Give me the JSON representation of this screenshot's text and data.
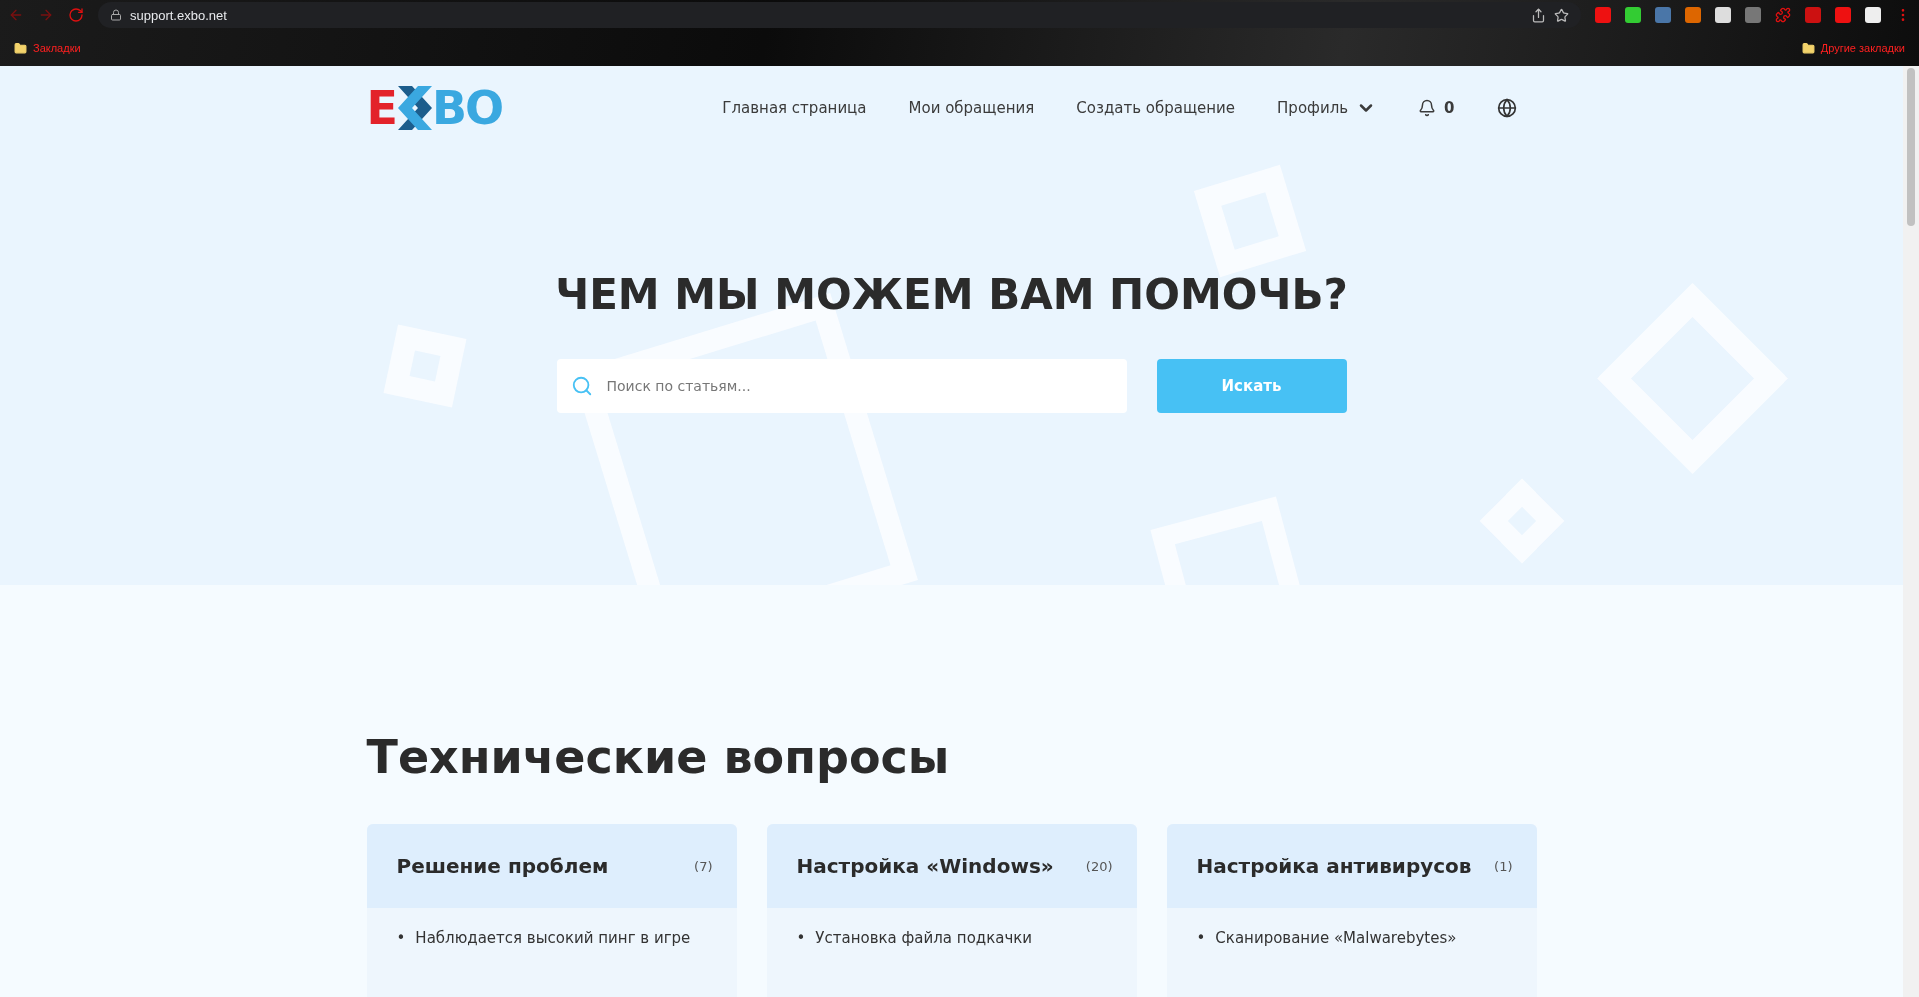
{
  "browser": {
    "url": "support.exbo.net",
    "bookmarks": "Закладки",
    "other_bookmarks": "Другие закладки"
  },
  "logo": {
    "left": "E",
    "right": "BO"
  },
  "nav": [
    {
      "label": "Главная страница",
      "kind": "link"
    },
    {
      "label": "Мои обращения",
      "kind": "link"
    },
    {
      "label": "Создать обращение",
      "kind": "link"
    },
    {
      "label": "Профиль",
      "kind": "dropdown"
    },
    {
      "label": "0",
      "kind": "notifications"
    },
    {
      "kind": "language"
    }
  ],
  "hero": {
    "title": "ЧЕМ МЫ МОЖЕМ ВАМ ПОМОЧЬ?",
    "search": {
      "placeholder": "Поиск по статьям..."
    },
    "button": "Искать"
  },
  "section": {
    "title": "Технические вопросы",
    "cards": [
      {
        "title": "Решение проблем",
        "count": "(7)",
        "items": [
          {
            "marker": "•",
            "text": "Наблюдается высокий пинг в игре"
          }
        ]
      },
      {
        "title": "Настройка «Windows»",
        "count": "(20)",
        "items": [
          {
            "marker": "•",
            "text": "Установка файла подкачки"
          }
        ]
      },
      {
        "title": "Настройка антивирусов",
        "count": "(1)",
        "items": [
          {
            "marker": "•",
            "text": "Сканирование «Malwarebytes»"
          }
        ]
      }
    ]
  }
}
